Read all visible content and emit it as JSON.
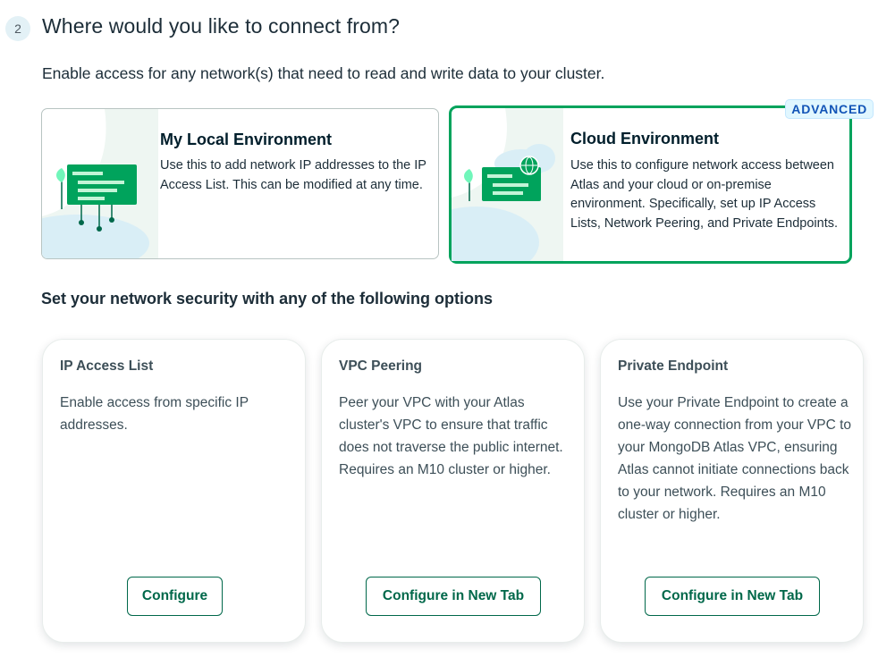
{
  "step": {
    "number": "2",
    "title": "Where would you like to connect from?"
  },
  "subtitle": "Enable access for any network(s) that need to read and write data to your cluster.",
  "environments": [
    {
      "title": "My Local Environment",
      "description": "Use this to add network IP addresses to the IP Access List. This can be modified at any time.",
      "selected": false
    },
    {
      "title": "Cloud Environment",
      "description": "Use this to configure network access between Atlas and your cloud or on-premise environment. Specifically, set up IP Access Lists, Network Peering, and Private Endpoints.",
      "badge": "ADVANCED",
      "selected": true
    }
  ],
  "security_title": "Set your network security with any of the following options",
  "options": [
    {
      "title": "IP Access List",
      "description": "Enable access from specific IP addresses.",
      "button": "Configure"
    },
    {
      "title": "VPC Peering",
      "description": "Peer your VPC with your Atlas cluster's VPC to ensure that traffic does not traverse the public internet. Requires an M10 cluster or higher.",
      "button": "Configure in New Tab"
    },
    {
      "title": "Private Endpoint",
      "description": "Use your Private Endpoint to create a one-way connection from your VPC to your MongoDB Atlas VPC, ensuring Atlas cannot initiate connections back to your network. Requires an M10 cluster or higher.",
      "button": "Configure in New Tab"
    }
  ],
  "colors": {
    "accent_green": "#00a35c",
    "button_green": "#00684a",
    "badge_blue": "#1254b7",
    "text_dark": "#001e2b"
  }
}
